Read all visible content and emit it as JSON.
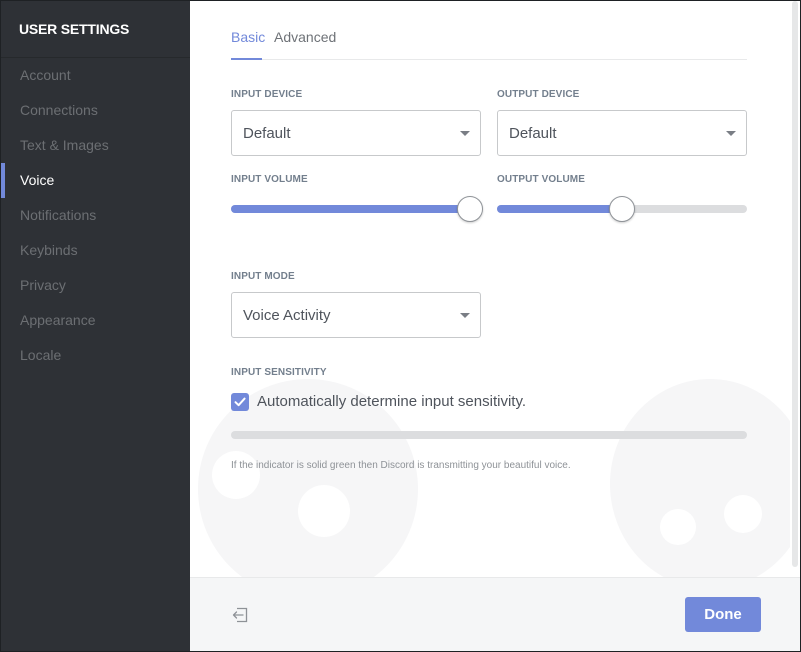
{
  "sidebar": {
    "title": "USER SETTINGS",
    "items": [
      {
        "label": "Account"
      },
      {
        "label": "Connections"
      },
      {
        "label": "Text & Images"
      },
      {
        "label": "Voice",
        "active": true
      },
      {
        "label": "Notifications"
      },
      {
        "label": "Keybinds"
      },
      {
        "label": "Privacy"
      },
      {
        "label": "Appearance"
      },
      {
        "label": "Locale"
      }
    ]
  },
  "tabs": {
    "basic": "Basic",
    "advanced": "Advanced",
    "active": "basic"
  },
  "voice": {
    "input_device": {
      "label": "INPUT DEVICE",
      "value": "Default"
    },
    "output_device": {
      "label": "OUTPUT DEVICE",
      "value": "Default"
    },
    "input_volume": {
      "label": "INPUT VOLUME",
      "level": 0.955
    },
    "output_volume": {
      "label": "OUTPUT VOLUME",
      "level": 0.5
    },
    "input_mode": {
      "label": "INPUT MODE",
      "value": "Voice Activity"
    },
    "input_sensitivity": {
      "label": "INPUT SENSITIVITY",
      "auto_label": "Automatically determine input sensitivity.",
      "auto_checked": true,
      "hint": "If the indicator is solid green then Discord is transmitting your beautiful voice."
    }
  },
  "footer": {
    "logout_icon": "logout-icon",
    "done_label": "Done"
  },
  "colors": {
    "accent": "#7289da",
    "sidebar_bg": "#2e3136",
    "track": "#dcdddf"
  }
}
